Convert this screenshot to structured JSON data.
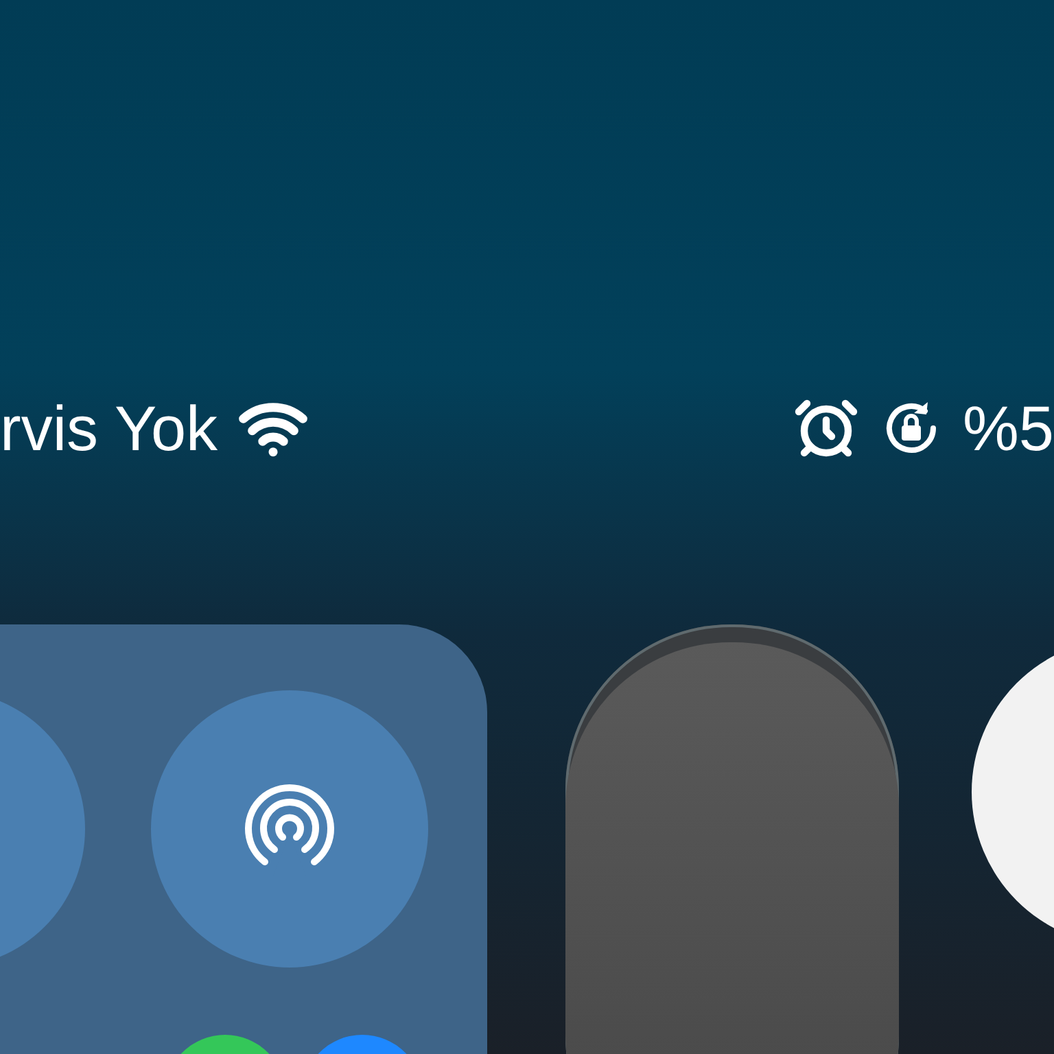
{
  "status_bar": {
    "carrier": "rvis Yok",
    "battery": "%5"
  },
  "brightness": {
    "level": 0.97
  }
}
